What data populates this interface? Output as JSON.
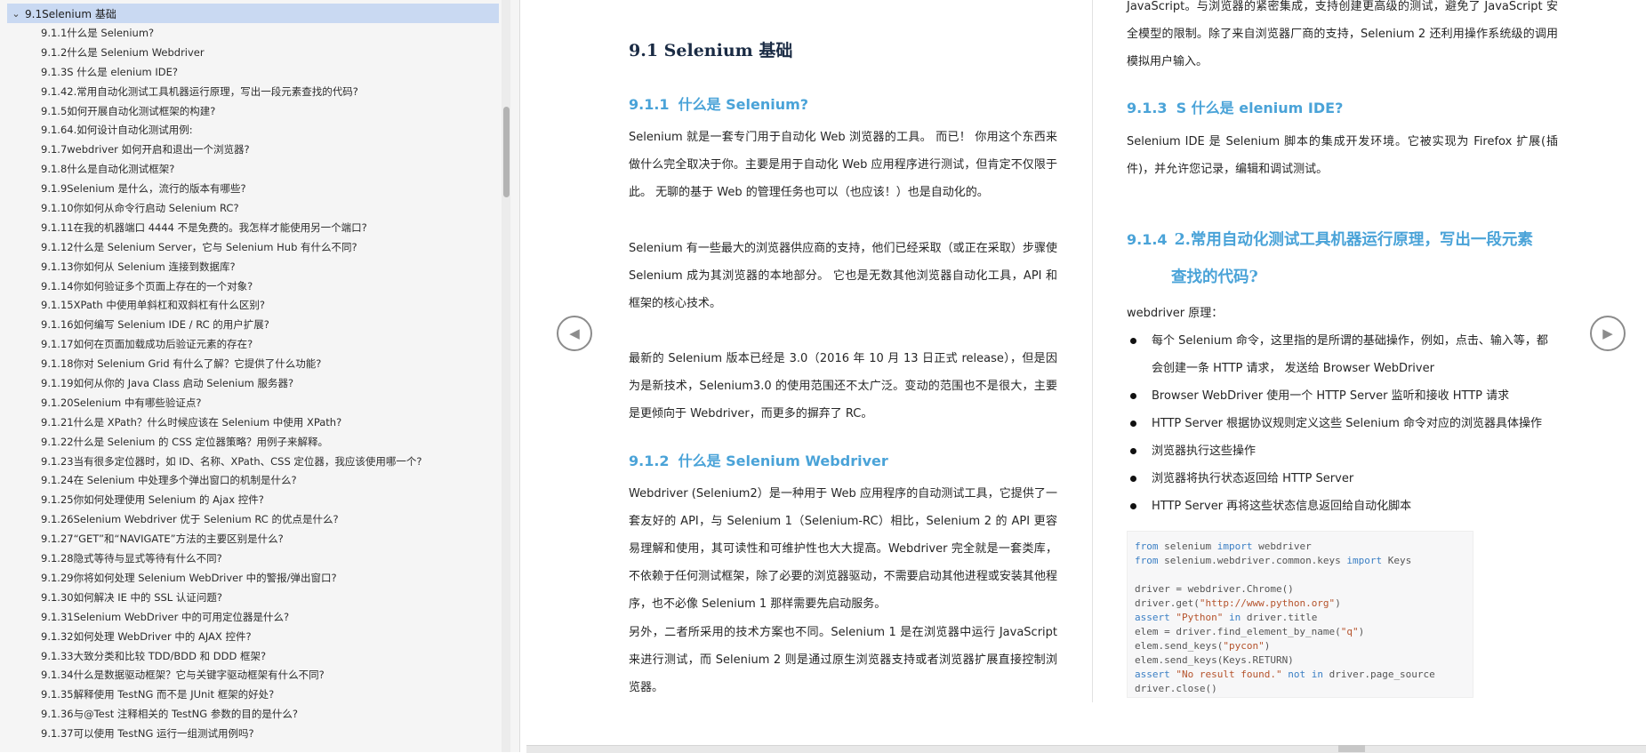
{
  "outline": {
    "root_label": "9.1Selenium 基础",
    "items": [
      "9.1.1什么是 Selenium?",
      "9.1.2什么是 Selenium Webdriver",
      "9.1.3S 什么是 elenium IDE?",
      "9.1.42.常用自动化测试工具机器运行原理，写出一段元素查找的代码?",
      "9.1.5如何开展自动化测试框架的构建?",
      "9.1.64.如何设计自动化测试用例:",
      "9.1.7webdriver 如何开启和退出一个浏览器?",
      "9.1.8什么是自动化测试框架?",
      "9.1.9Selenium 是什么，流行的版本有哪些?",
      "9.1.10你如何从命令行启动 Selenium RC?",
      "9.1.11在我的机器端口 4444 不是免费的。我怎样才能使用另一个端口?",
      "9.1.12什么是 Selenium Server，它与 Selenium Hub 有什么不同?",
      "9.1.13你如何从 Selenium 连接到数据库?",
      "9.1.14你如何验证多个页面上存在的一个对象?",
      "9.1.15XPath 中使用单斜杠和双斜杠有什么区别?",
      "9.1.16如何编写 Selenium IDE / RC 的用户扩展?",
      "9.1.17如何在页面加载成功后验证元素的存在?",
      "9.1.18你对 Selenium Grid 有什么了解？它提供了什么功能?",
      "9.1.19如何从你的 Java Class 启动 Selenium 服务器?",
      "9.1.20Selenium 中有哪些验证点?",
      "9.1.21什么是 XPath？什么时候应该在 Selenium 中使用 XPath?",
      "9.1.22什么是 Selenium 的 CSS 定位器策略？用例子来解释。",
      "9.1.23当有很多定位器时，如 ID、名称、XPath、CSS 定位器，我应该使用哪一个?",
      "9.1.24在 Selenium 中处理多个弹出窗口的机制是什么?",
      "9.1.25你如何处理使用 Selenium 的 Ajax 控件?",
      "9.1.26Selenium Webdriver 优于 Selenium RC 的优点是什么?",
      "9.1.27“GET”和“NAVIGATE”方法的主要区别是什么?",
      "9.1.28隐式等待与显式等待有什么不同?",
      "9.1.29你将如何处理 Selenium WebDriver 中的警报/弹出窗口?",
      "9.1.30如何解决 IE 中的 SSL 认证问题?",
      "9.1.31Selenium WebDriver 中的可用定位器是什么?",
      "9.1.32如何处理 WebDriver 中的 AJAX 控件?",
      "9.1.33大致分类和比较 TDD/BDD 和 DDD 框架?",
      "9.1.34什么是数据驱动框架？它与关键字驱动框架有什么不同?",
      "9.1.35解释使用 TestNG 而不是 JUnit 框架的好处?",
      "9.1.36与@Test 注释相关的 TestNG 参数的目的是什么?",
      "9.1.37可以使用 TestNG 运行一组测试用例吗?"
    ]
  },
  "left_page": {
    "section_title": "9.1 Selenium 基础",
    "s1_num": "9.1.1",
    "s1_title": "什么是 Selenium?",
    "p1": "Selenium 就是一套专门用于自动化 Web 浏览器的工具。 而已！ 你用这个东西来做什么完全取决于你。主要是用于自动化 Web 应用程序进行测试，但肯定不仅限于此。 无聊的基于 Web 的管理任务也可以（也应该！）也是自动化的。",
    "p2": "Selenium 有一些最大的浏览器供应商的支持，他们已经采取（或正在采取）步骤使 Selenium 成为其浏览器的本地部分。 它也是无数其他浏览器自动化工具，API 和框架的核心技术。",
    "p3": "最新的 Selenium 版本已经是 3.0（2016 年 10 月 13 日正式 release），但是因为是新技术，Selenium3.0 的使用范围还不太广泛。变动的范围也不是很大，主要是更倾向于 Webdriver，而更多的摒弃了 RC。",
    "s2_num": "9.1.2",
    "s2_title": "什么是 Selenium Webdriver",
    "p4": "Webdriver (Selenium2）是一种用于 Web 应用程序的自动测试工具，它提供了一套友好的 API，与 Selenium 1（Selenium-RC）相比，Selenium 2 的 API 更容易理解和使用，其可读性和可维护性也大大提高。Webdriver 完全就是一套类库，不依赖于任何测试框架，除了必要的浏览器驱动，不需要启动其他进程或安装其他程序，也不必像 Selenium 1 那样需要先启动服务。",
    "p5": "另外，二者所采用的技术方案也不同。Selenium 1 是在浏览器中运行 JavaScript 来进行测试，而 Selenium 2 则是通过原生浏览器支持或者浏览器扩展直接控制浏览器。"
  },
  "right_page": {
    "cont_text": "JavaScript。与浏览器的紧密集成，支持创建更高级的测试，避免了 JavaScript 安全模型的限制。除了来自浏览器厂商的支持，Selenium 2 还利用操作系统级的调用模拟用户输入。",
    "s3_num": "9.1.3",
    "s3_title": "S 什么是 elenium IDE?",
    "p6": "Selenium IDE 是 Selenium 脚本的集成开发环境。它被实现为 Firefox 扩展(插件)，并允许您记录，编辑和调试测试。",
    "s4_num": "9.1.4",
    "s4_title_line1": "2.常用自动化测试工具机器运行原理，写出一段元素",
    "s4_title_line2": "查找的代码?",
    "principle_label": "webdriver 原理：",
    "bullets": [
      "每个 Selenium 命令，这里指的是所谓的基础操作，例如，点击、输入等，都会创建一条 HTTP 请求， 发送给 Browser WebDriver",
      "Browser WebDriver 使用一个 HTTP Server 监听和接收 HTTP 请求",
      "HTTP Server 根据协议规则定义这些 Selenium 命令对应的浏览器具体操作",
      "浏览器执行这些操作",
      "浏览器将执行状态返回给 HTTP Server",
      "HTTP Server 再将这些状态信息返回给自动化脚本"
    ],
    "code_lines": [
      "from selenium import webdriver",
      "from selenium.webdriver.common.keys import Keys",
      "",
      "driver = webdriver.Chrome()",
      "driver.get(\"http://www.python.org\")",
      "assert \"Python\" in driver.title",
      "elem = driver.find_element_by_name(\"q\")",
      "elem.send_keys(\"pycon\")",
      "elem.send_keys(Keys.RETURN)",
      "assert \"No result found.\" not in driver.page_source",
      "driver.close()"
    ]
  },
  "icons": {
    "collapse": "chevron-down-icon",
    "prev_page": "chevron-left-icon",
    "next_page": "chevron-right-icon"
  },
  "colors": {
    "heading_blue": "#4aa3d8",
    "outline_selected": "#c9d9f2",
    "code_keyword": "#3b7fc4",
    "code_string": "#b5532c"
  }
}
